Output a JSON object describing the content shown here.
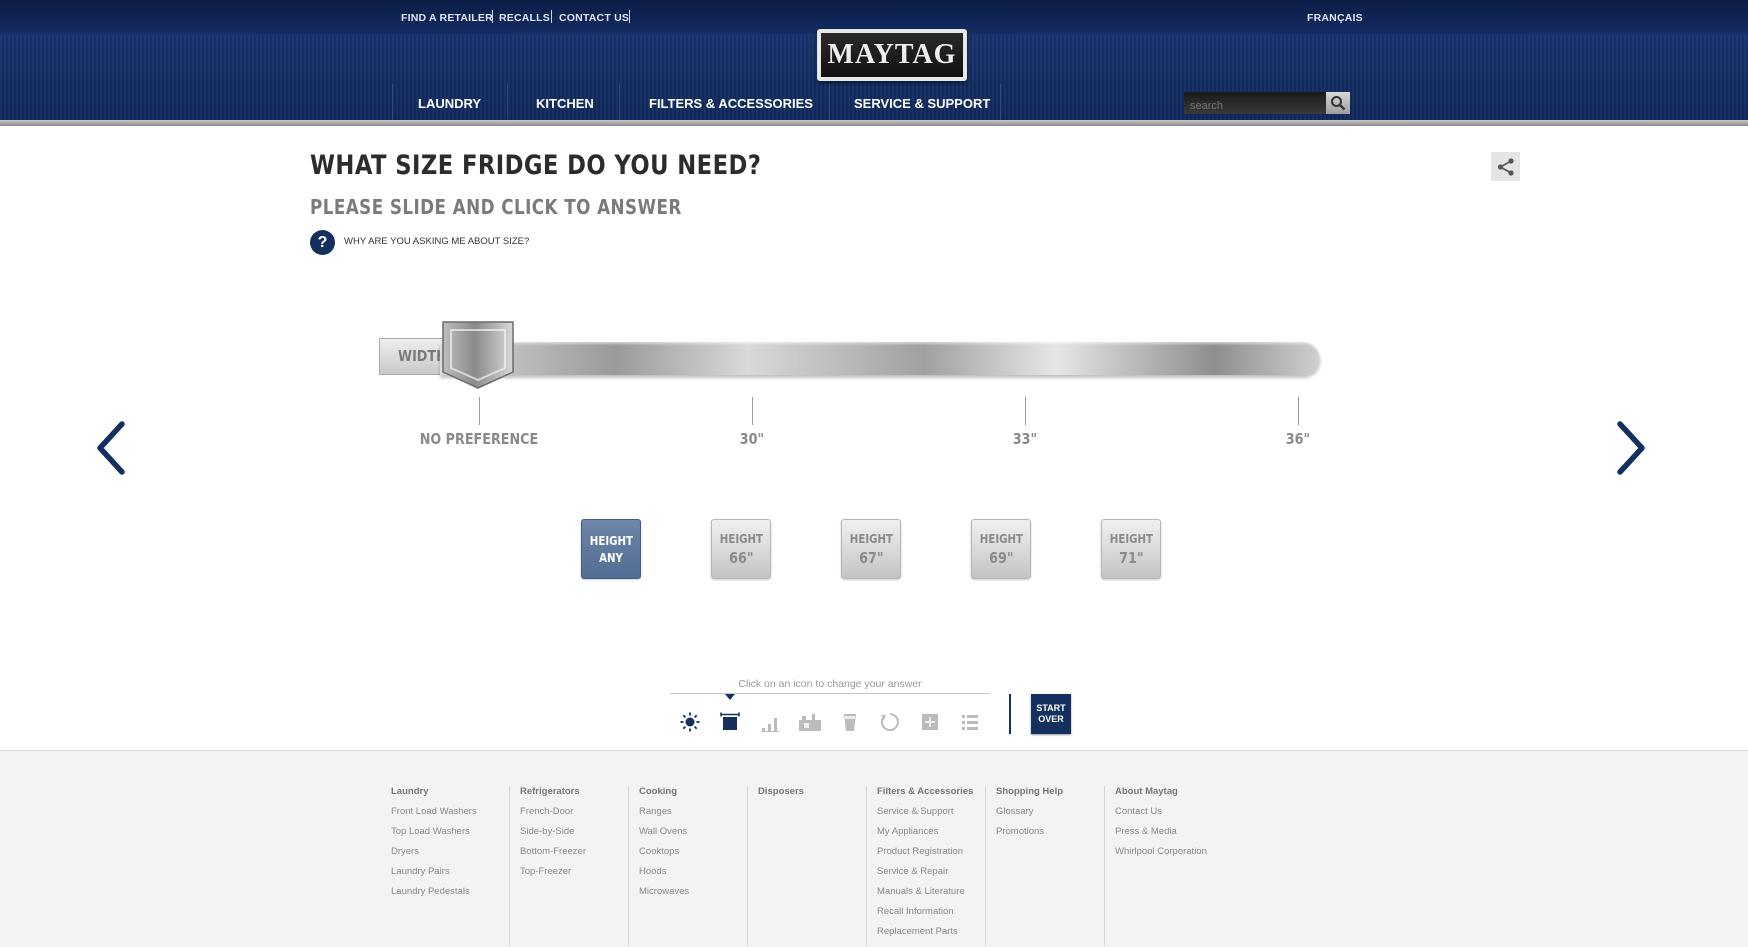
{
  "utility_nav": [
    "FIND A RETAILER",
    "RECALLS",
    "CONTACT US"
  ],
  "language_link": "FRANÇAIS",
  "brand": "MAYTAG",
  "main_nav": [
    "LAUNDRY",
    "KITCHEN",
    "FILTERS & ACCESSORIES",
    "SERVICE & SUPPORT"
  ],
  "search": {
    "placeholder": "search"
  },
  "question": {
    "title": "WHAT SIZE FRIDGE DO YOU NEED?",
    "subtitle": "PLEASE SLIDE AND CLICK TO ANSWER",
    "help_text": "WHY ARE YOU ASKING ME ABOUT SIZE?"
  },
  "width_slider": {
    "label": "WIDTH",
    "ticks": [
      "NO PREFERENCE",
      "30\"",
      "33\"",
      "36\""
    ],
    "selected": "NO PREFERENCE"
  },
  "height_options": [
    {
      "label": "HEIGHT",
      "value": "ANY",
      "active": true
    },
    {
      "label": "HEIGHT",
      "value": "66\"",
      "active": false
    },
    {
      "label": "HEIGHT",
      "value": "67\"",
      "active": false
    },
    {
      "label": "HEIGHT",
      "value": "69\"",
      "active": false
    },
    {
      "label": "HEIGHT",
      "value": "71\"",
      "active": false
    }
  ],
  "answer_bar": {
    "hint": "Click on an icon to change your answer",
    "icons": [
      "sun-icon",
      "fridge-size-icon",
      "bars-icon",
      "kitchen-icon",
      "cup-icon",
      "refresh-icon",
      "plus-box-icon",
      "list-icon"
    ],
    "start_over": "START OVER"
  },
  "footer": {
    "columns": [
      {
        "heading": "Laundry",
        "links": [
          "Front Load Washers",
          "Top Load Washers",
          "Dryers",
          "Laundry Pairs",
          "Laundry Pedestals"
        ]
      },
      {
        "heading": "Refrigerators",
        "links": [
          "French-Door",
          "Side-by-Side",
          "Bottom-Freezer",
          "Top-Freezer"
        ]
      },
      {
        "heading": "Cooking",
        "links": [
          "Ranges",
          "Wall Ovens",
          "Cooktops",
          "Hoods",
          "Microwaves"
        ]
      },
      {
        "heading": "Disposers",
        "links": []
      },
      {
        "heading": "Filters & Accessories",
        "links": [
          "Service & Support",
          "My Appliances",
          "Product Registration",
          "Service & Repair",
          "Manuals & Literature",
          "Recall Information",
          "Replacement Parts"
        ]
      },
      {
        "heading": "Shopping Help",
        "links": [
          "Glossary",
          "Promotions"
        ]
      },
      {
        "heading": "About Maytag",
        "links": [
          "Contact Us",
          "Press & Media",
          "Whirlpool Corporation"
        ]
      }
    ]
  },
  "colors": {
    "navy": "#13305f",
    "header_blue": "#163169",
    "active_button": "#5f7aa0"
  }
}
